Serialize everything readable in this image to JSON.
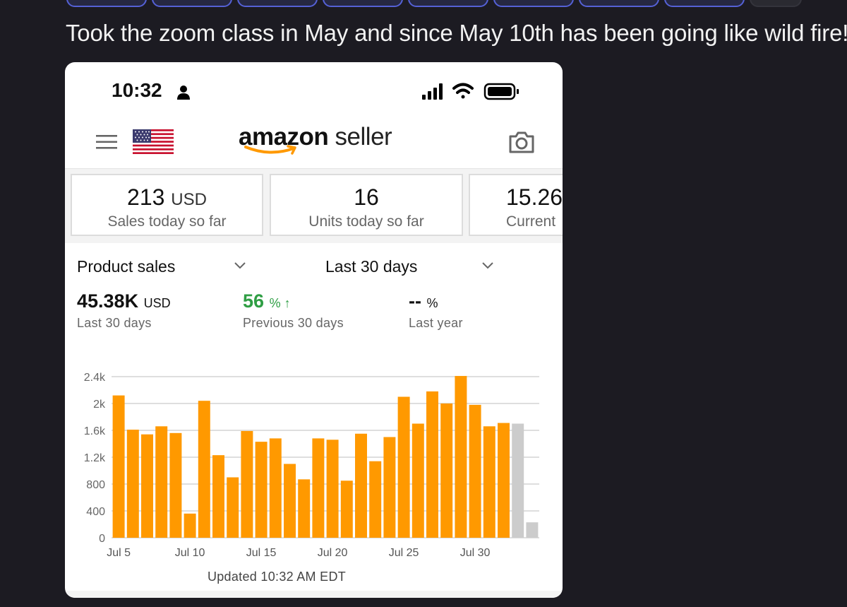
{
  "post": {
    "text": "Took the zoom class in May and since May 10th has been going like wild fire!"
  },
  "status_bar": {
    "time": "10:32"
  },
  "header": {
    "logo_bold": "amazon",
    "logo_light": "seller"
  },
  "metrics": [
    {
      "value": "213",
      "unit": "USD",
      "label": "Sales today so far"
    },
    {
      "value": "16",
      "unit": "",
      "label": "Units today so far"
    },
    {
      "value": "15.26",
      "unit": "",
      "label": "Current"
    }
  ],
  "product_sales": {
    "metric_select": "Product sales",
    "range_select": "Last 30 days",
    "total_value": "45.38K",
    "total_unit": "USD",
    "total_label": "Last 30 days",
    "change_value": "56",
    "change_unit": "% ↑",
    "change_label": "Previous 30 days",
    "yoy_value": "--",
    "yoy_unit": "%",
    "yoy_label": "Last year"
  },
  "colors": {
    "bar": "#ff9900",
    "bar_today": "#cccccc",
    "positive": "#2f9e44"
  },
  "chart_data": {
    "type": "bar",
    "title": "",
    "xlabel": "",
    "ylabel": "",
    "ylim": [
      0,
      2400
    ],
    "yticks": [
      "0",
      "400",
      "800",
      "1.2k",
      "1.6k",
      "2k",
      "2.4k"
    ],
    "xtick_labels": [
      "Jul 5",
      "Jul 10",
      "Jul 15",
      "Jul 20",
      "Jul 25",
      "Jul 30"
    ],
    "series": [
      {
        "values": [
          2120,
          1610,
          1540,
          1660,
          1560,
          360,
          2040,
          1230,
          900,
          1590,
          1430,
          1480,
          1100,
          870,
          1480,
          1460,
          850,
          1550,
          1140,
          1500,
          2100,
          1700,
          2180,
          2000,
          2410,
          1980,
          1660,
          1710,
          1700,
          230
        ]
      }
    ],
    "today_bars": 2
  },
  "footer": {
    "updated": "Updated 10:32 AM EDT"
  }
}
